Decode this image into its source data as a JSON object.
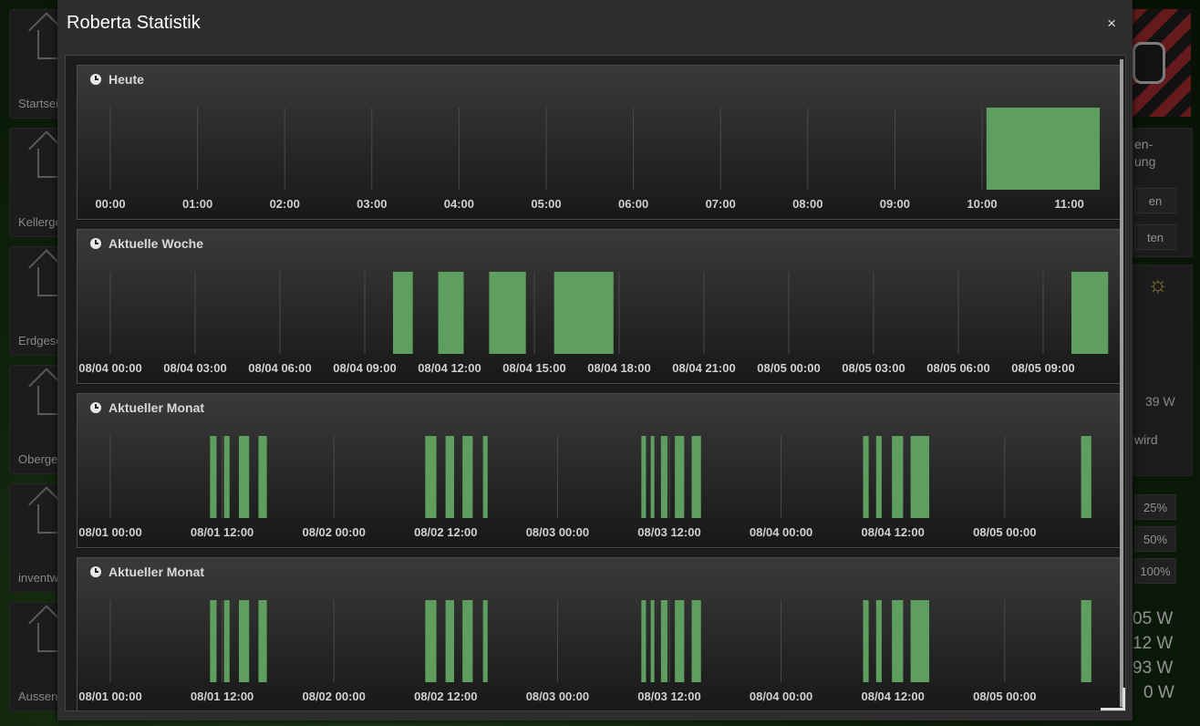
{
  "background": {
    "tiles": [
      {
        "label": "Startsei"
      },
      {
        "label": "Kellerge"
      },
      {
        "label": "Erdgesc"
      },
      {
        "label": "Oberge"
      },
      {
        "label": "inventw"
      },
      {
        "label": "Aussen"
      }
    ],
    "right": {
      "text1": "en-",
      "text2": "ung",
      "btn_on": "en",
      "btn_off": "ten",
      "power": "39 W",
      "wird": "wird",
      "pct1": "25%",
      "pct2": "50%",
      "pct3": "100%",
      "w1": "05 W",
      "w2": "12 W",
      "w3": "93 W",
      "w4": "0 W"
    }
  },
  "modal": {
    "title": "Roberta Statistik",
    "close": "×"
  },
  "colors": {
    "bar": "#5e9e5e",
    "grid": "#4a4a4a",
    "label": "#d0d0d0"
  },
  "chart_data": [
    {
      "type": "bar",
      "title": "Heute",
      "x": [
        "00:00",
        "01:00",
        "02:00",
        "03:00",
        "04:00",
        "05:00",
        "06:00",
        "07:00",
        "08:00",
        "09:00",
        "10:00",
        "11:00"
      ],
      "x_unit": "hour",
      "xlim": [
        0,
        11.35
      ],
      "intervals": [
        [
          10.05,
          11.35
        ]
      ]
    },
    {
      "type": "bar",
      "title": "Aktuelle Woche",
      "x": [
        "08/04 00:00",
        "08/04 03:00",
        "08/04 06:00",
        "08/04 09:00",
        "08/04 12:00",
        "08/04 15:00",
        "08/04 18:00",
        "08/04 21:00",
        "08/05 00:00",
        "08/05 03:00",
        "08/05 06:00",
        "08/05 09:00"
      ],
      "x_unit": "hour",
      "x_step": 3,
      "xlim": [
        0,
        35.0
      ],
      "intervals": [
        [
          10.0,
          10.7
        ],
        [
          11.6,
          12.5
        ],
        [
          13.4,
          14.7
        ],
        [
          15.7,
          17.8
        ],
        [
          34.0,
          35.3
        ]
      ]
    },
    {
      "type": "bar",
      "title": "Aktueller Monat",
      "x": [
        "08/01 00:00",
        "08/01 12:00",
        "08/02 00:00",
        "08/02 12:00",
        "08/03 00:00",
        "08/03 12:00",
        "08/04 00:00",
        "08/04 12:00",
        "08/05 00:00"
      ],
      "x_unit": "hour",
      "x_step": 12,
      "xlim": [
        0,
        107.0
      ],
      "intervals": [
        [
          10.7,
          11.4
        ],
        [
          12.2,
          12.8
        ],
        [
          13.8,
          14.9
        ],
        [
          15.9,
          16.8
        ],
        [
          33.8,
          35.0
        ],
        [
          36.0,
          36.9
        ],
        [
          37.8,
          38.9
        ],
        [
          40.0,
          40.5
        ],
        [
          57.0,
          57.5
        ],
        [
          58.0,
          58.4
        ],
        [
          59.1,
          59.8
        ],
        [
          60.6,
          61.6
        ],
        [
          62.4,
          63.4
        ],
        [
          80.8,
          81.4
        ],
        [
          82.2,
          82.8
        ],
        [
          83.9,
          85.1
        ],
        [
          85.9,
          87.9
        ],
        [
          104.2,
          105.3
        ]
      ]
    },
    {
      "type": "bar",
      "title": "Aktueller Monat",
      "x": [
        "08/01 00:00",
        "08/01 12:00",
        "08/02 00:00",
        "08/02 12:00",
        "08/03 00:00",
        "08/03 12:00",
        "08/04 00:00",
        "08/04 12:00",
        "08/05 00:00"
      ],
      "x_unit": "hour",
      "x_step": 12,
      "xlim": [
        0,
        107.0
      ],
      "intervals": [
        [
          10.7,
          11.4
        ],
        [
          12.2,
          12.8
        ],
        [
          13.8,
          14.9
        ],
        [
          15.9,
          16.8
        ],
        [
          33.8,
          35.0
        ],
        [
          36.0,
          36.9
        ],
        [
          37.8,
          38.9
        ],
        [
          40.0,
          40.5
        ],
        [
          57.0,
          57.5
        ],
        [
          58.0,
          58.4
        ],
        [
          59.1,
          59.8
        ],
        [
          60.6,
          61.6
        ],
        [
          62.4,
          63.4
        ],
        [
          80.8,
          81.4
        ],
        [
          82.2,
          82.8
        ],
        [
          83.9,
          85.1
        ],
        [
          85.9,
          87.9
        ],
        [
          104.2,
          105.3
        ]
      ]
    }
  ]
}
